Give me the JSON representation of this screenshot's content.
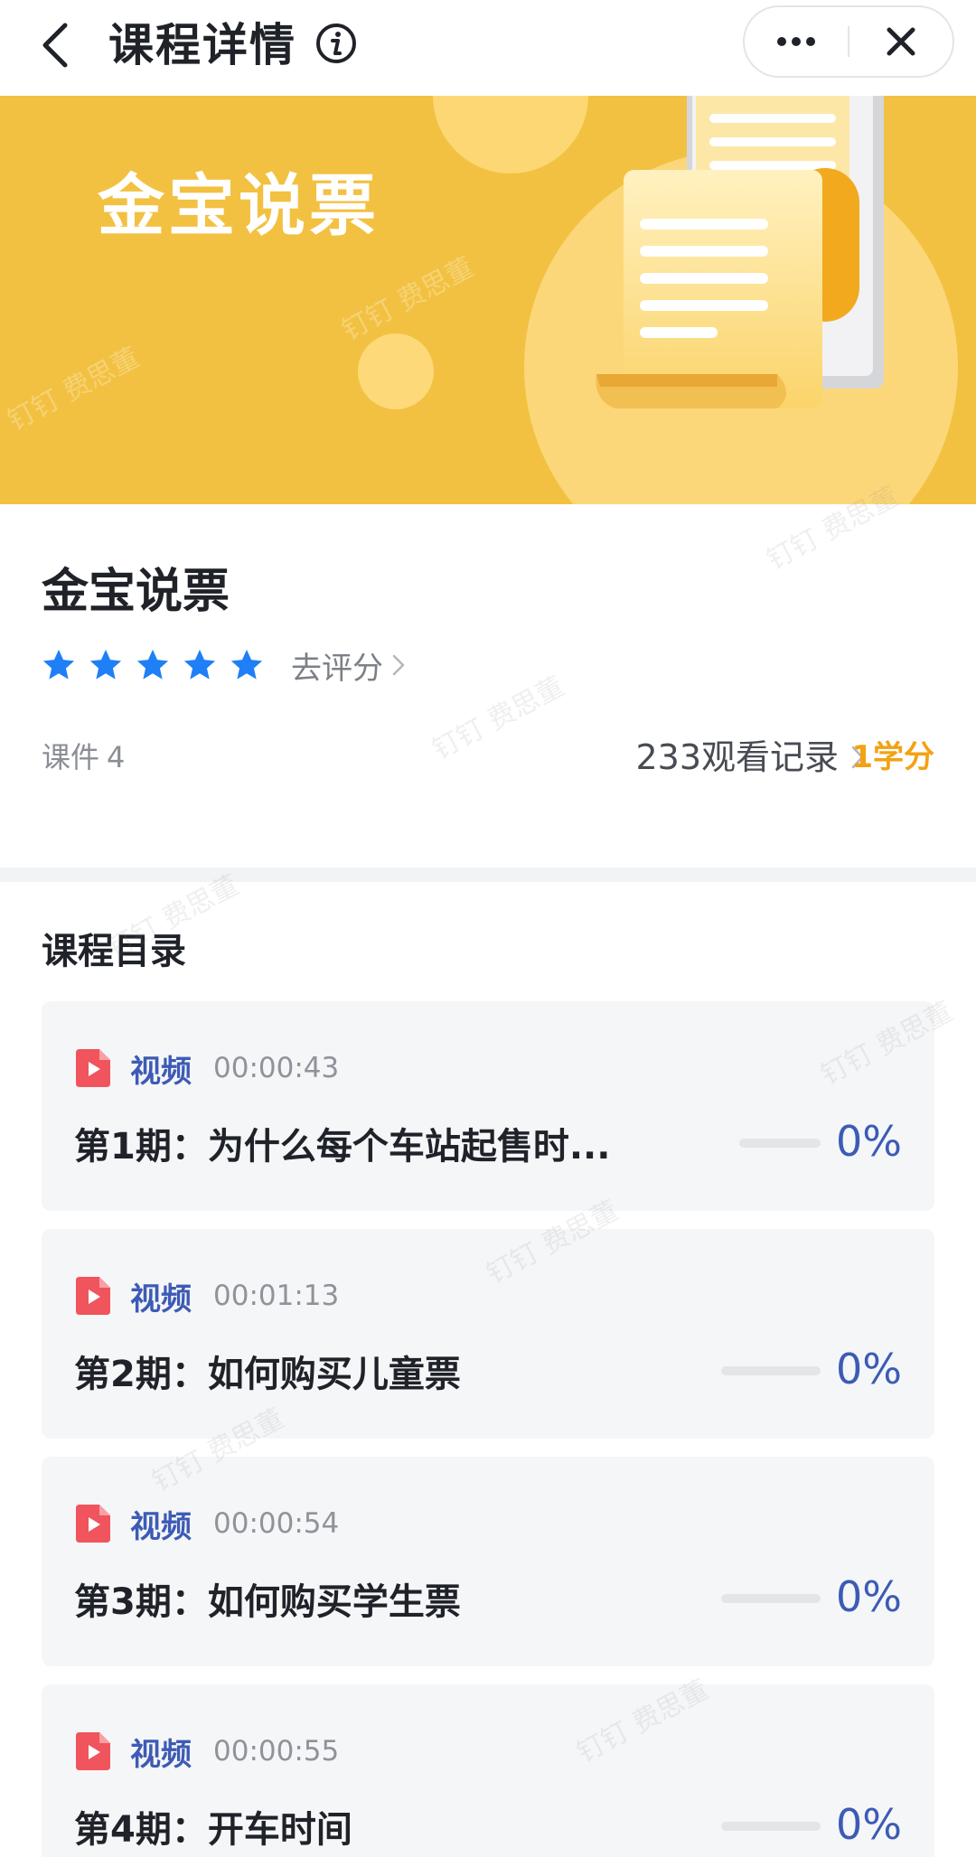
{
  "navbar": {
    "title": "课程详情",
    "back_icon": "chevron-left-icon",
    "info_icon": "info-icon",
    "more_icon": "more-horizontal-icon",
    "close_icon": "close-icon"
  },
  "banner": {
    "title": "金宝说票",
    "background_color": "#f3c141"
  },
  "course": {
    "title": "金宝说票",
    "rating": 5,
    "rating_max": 5,
    "rate_link": "去评分",
    "courseware_label": "课件",
    "courseware_count": "4",
    "views": "233观看记录",
    "credit": "1学分",
    "star_color": "#1f7ff6",
    "credit_color": "#f3a214"
  },
  "catalog": {
    "title": "课程目录",
    "lessons": [
      {
        "type": "视频",
        "duration": "00:00:43",
        "title": "第1期：为什么每个车站起售时...",
        "progress": 0,
        "progress_label": "0%"
      },
      {
        "type": "视频",
        "duration": "00:01:13",
        "title": "第2期：如何购买儿童票",
        "progress": 0,
        "progress_label": "0%"
      },
      {
        "type": "视频",
        "duration": "00:00:54",
        "title": "第3期：如何购买学生票",
        "progress": 0,
        "progress_label": "0%"
      },
      {
        "type": "视频",
        "duration": "00:00:55",
        "title": "第4期：开车时间",
        "progress": 0,
        "progress_label": "0%"
      }
    ],
    "accent_color": "#3d5bb5",
    "video_icon": "video-file-icon"
  },
  "watermark": "钉钉 费思董"
}
